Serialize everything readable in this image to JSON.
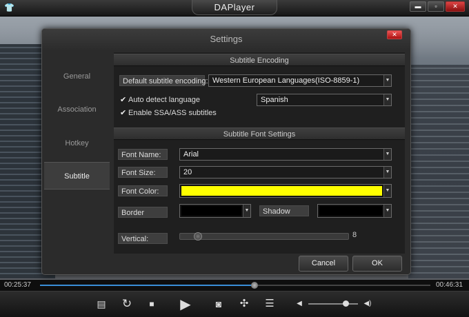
{
  "window": {
    "title": "DAPlayer",
    "min_glyph": "▬",
    "max_glyph": "▫",
    "close_glyph": "✕"
  },
  "dialog": {
    "title": "Settings",
    "close_glyph": "✕",
    "sidebar": [
      {
        "label": "General",
        "active": false
      },
      {
        "label": "Association",
        "active": false
      },
      {
        "label": "Hotkey",
        "active": false
      },
      {
        "label": "Subtitle",
        "active": true
      }
    ],
    "encoding_section": {
      "header": "Subtitle Encoding",
      "default_label": "Default subtitle encoding:",
      "default_value": "Western European Languages(ISO-8859-1)",
      "auto_detect_label": "Auto detect language",
      "auto_detect_checked": true,
      "language_value": "Spanish",
      "ssa_label": "Enable SSA/ASS subtitles",
      "ssa_checked": true
    },
    "font_section": {
      "header": "Subtitle Font Settings",
      "font_name_label": "Font Name:",
      "font_name_value": "Arial",
      "font_size_label": "Font Size:",
      "font_size_value": "20",
      "font_color_label": "Font Color:",
      "font_color": "#ffff00",
      "border_label": "Border",
      "border_color": "#000000",
      "shadow_label": "Shadow",
      "shadow_color": "#000000",
      "vertical_label": "Vertical:",
      "vertical_value": "8"
    },
    "buttons": {
      "cancel": "Cancel",
      "ok": "OK"
    }
  },
  "player": {
    "current_time": "00:25:37",
    "total_time": "00:46:31",
    "progress": 0.55,
    "volume": 0.75,
    "accent_color": "#3a8ed8",
    "controls": [
      {
        "name": "open-folder-icon",
        "glyph": "▤"
      },
      {
        "name": "repeat-icon",
        "glyph": "↻"
      },
      {
        "name": "stop-icon",
        "glyph": "■"
      },
      {
        "name": "play-icon",
        "glyph": "▶"
      },
      {
        "name": "camera-icon",
        "glyph": "◙"
      },
      {
        "name": "fullscreen-icon",
        "glyph": "✣"
      },
      {
        "name": "playlist-icon",
        "glyph": "☰"
      }
    ],
    "volume_low_glyph": "◀",
    "volume_high_glyph": "◀)"
  }
}
